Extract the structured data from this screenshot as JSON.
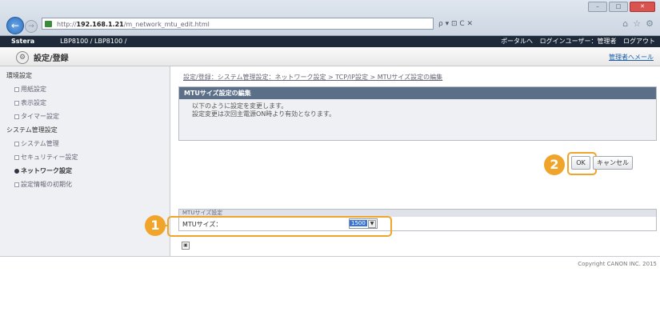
{
  "browser": {
    "address_prefix": "http://",
    "address_host": "192.168.1.21",
    "address_path": "/m_network_mtu_edit.html",
    "search_controls": "ρ ▾ ⊡ C ✕",
    "home_icon": "home-icon",
    "star_icon": "star-icon",
    "gear_icon": "gear-icon"
  },
  "app": {
    "brand": "Sstera",
    "model": "LBP8100 / LBP8100 /",
    "header_links": [
      "ポータルへ",
      "ログインユーザー：管理者",
      "ログアウト"
    ]
  },
  "page": {
    "title": "設定/登録",
    "mail_link": "管理者へメール"
  },
  "sidebar": {
    "section1": "環境設定",
    "section1_items": [
      "用紙設定",
      "表示設定",
      "タイマー設定"
    ],
    "section2": "システム管理設定",
    "section2_items": [
      "システム管理",
      "セキュリティー設定",
      "ネットワーク設定",
      "設定情報の初期化"
    ],
    "active_item": "ネットワーク設定"
  },
  "main": {
    "breadcrumb": "設定/登録：システム管理設定：ネットワーク設定 > TCP/IP設定 > MTUサイズ設定の編集",
    "box_title": "MTUサイズ設定の編集",
    "message_line1": "以下のように設定を変更します。",
    "message_line2": "設定変更は次回主電源ON時より有効となります。",
    "ok_label": "OK",
    "cancel_label": "キャンセル",
    "table_header": "MTUサイズ設定",
    "mtu_label": "MTUサイズ：",
    "mtu_value": "1500",
    "help_glyph": "▣"
  },
  "footer": {
    "copyright": "Copyright CANON INC. 2015"
  },
  "callouts": [
    "1",
    "2"
  ],
  "colors": {
    "accent": "#f0a52a",
    "header_dark": "#1e2a39",
    "box_title": "#5b6f89"
  }
}
